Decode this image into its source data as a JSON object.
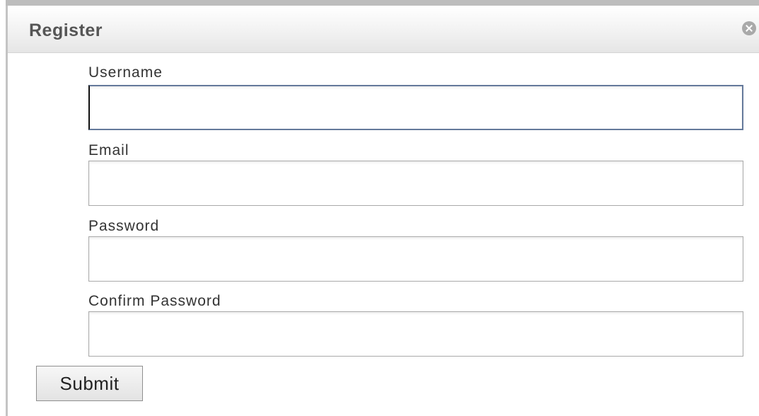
{
  "dialog": {
    "title": "Register",
    "close_icon": "close-circle-icon"
  },
  "form": {
    "fields": [
      {
        "label": "Username",
        "value": "",
        "placeholder": ""
      },
      {
        "label": "Email",
        "value": "",
        "placeholder": ""
      },
      {
        "label": "Password",
        "value": "",
        "placeholder": ""
      },
      {
        "label": "Confirm Password",
        "value": "",
        "placeholder": ""
      }
    ],
    "submit_label": "Submit"
  },
  "colors": {
    "title_text": "#555555",
    "focused_border": "#64799b",
    "border": "#aaaaaa"
  }
}
